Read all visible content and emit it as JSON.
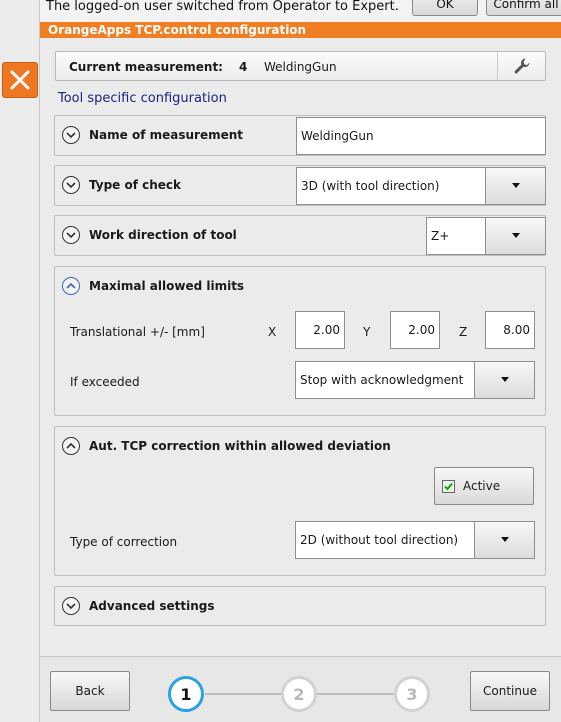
{
  "notification": {
    "text": "The logged-on user switched from Operator to Expert.",
    "ok_label": "OK",
    "confirm_all_label": "Confirm all"
  },
  "header": {
    "title": "OrangeApps TCP.control configuration"
  },
  "current_measurement": {
    "label": "Current measurement:",
    "number": "4",
    "tool": "WeldingGun"
  },
  "section_title": "Tool specific configuration",
  "name_of_measurement": {
    "title": "Name of measurement",
    "value": "WeldingGun"
  },
  "type_of_check": {
    "title": "Type of check",
    "value": "3D (with tool direction)"
  },
  "work_direction": {
    "title": "Work direction of tool",
    "value": "Z+"
  },
  "limits": {
    "title": "Maximal allowed limits",
    "translational_label": "Translational +/- [mm]",
    "x_label": "X",
    "x_value": "2.00",
    "y_label": "Y",
    "y_value": "2.00",
    "z_label": "Z",
    "z_value": "8.00",
    "if_exceeded_label": "If exceeded",
    "if_exceeded_value": "Stop with acknowledgment"
  },
  "tcp_correction": {
    "title": "Aut. TCP correction within allowed deviation",
    "active_label": "Active",
    "active_checked": true,
    "type_label": "Type of correction",
    "type_value": "2D (without tool direction)"
  },
  "advanced": {
    "title": "Advanced settings"
  },
  "footer": {
    "back_label": "Back",
    "continue_label": "Continue",
    "steps": [
      "1",
      "2",
      "3"
    ],
    "current_step": 1
  },
  "colors": {
    "accent_orange": "#f07f24",
    "close_orange": "#ef7722",
    "step_active": "#2aa1e3",
    "section_title": "#1a237e"
  },
  "icons": {
    "close": "close-icon",
    "wrench": "wrench-icon",
    "chevron_down": "chevron-down-icon",
    "chevron_up": "chevron-up-icon",
    "dropdown_caret": "caret-down-icon",
    "checkbox": "checkbox-checked-icon"
  }
}
